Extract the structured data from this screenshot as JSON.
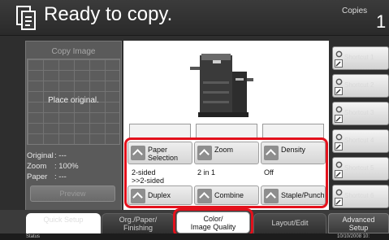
{
  "header": {
    "title": "Ready to copy.",
    "copies_label": "Copies",
    "copies_value": "1"
  },
  "left_panel": {
    "copy_image_label": "Copy Image",
    "place_original": "Place original.",
    "info": [
      {
        "key": "Original",
        "value": ": ---"
      },
      {
        "key": "Zoom",
        "value": ": 100%"
      },
      {
        "key": "Paper",
        "value": ": ---"
      }
    ],
    "preview_label": "Preview"
  },
  "options": {
    "row1": [
      {
        "label": "Paper Selection",
        "line1": "Paper",
        "line2": "Selection"
      },
      {
        "label": "Zoom"
      },
      {
        "label": "Density"
      }
    ],
    "row2_values": [
      {
        "line1": "2-sided",
        "line2": ">>2-sided"
      },
      {
        "line1": "2 in 1"
      },
      {
        "line1": "Off"
      }
    ],
    "row2_buttons": [
      {
        "label": "Duplex"
      },
      {
        "label": "Combine"
      },
      {
        "label": "Staple/Punch"
      }
    ]
  },
  "shortcuts": [
    "Shortcut 1",
    "Shortcut 2",
    "Shortcut 3",
    "Shortcut 4",
    "Shortcut 5",
    "Shortcut 6"
  ],
  "tabs": {
    "quick_setup": "Quick Setup",
    "org_finishing_line1": "Org./Paper/",
    "org_finishing_line2": "Finishing",
    "color_line1": "Color/",
    "color_line2": "Image Quality",
    "layout_edit": "Layout/Edit",
    "advanced_line1": "Advanced",
    "advanced_line2": "Setup"
  },
  "status_bar": {
    "status_label": "Status",
    "date": "10/10/2008  10:"
  },
  "colors": {
    "highlight": "#e3111c",
    "panel_bg": "#2e2e2e",
    "white": "#ffffff"
  }
}
